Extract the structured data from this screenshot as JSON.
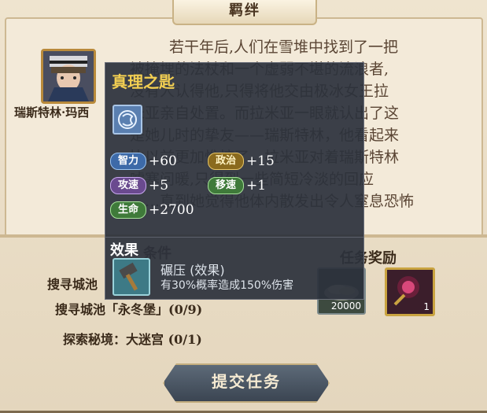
{
  "panel": {
    "title": "羁绊"
  },
  "hero": {
    "name": "瑞斯特林·玛西"
  },
  "story": {
    "lines": [
      "若干年后,人们在雪堆中找到了一把",
      "被掩埋的法杖和一个虚弱不堪的流浪者,",
      "没有人认得他,只得将他交由极冰女王拉",
      "米亚亲自处置。而拉米亚一眼就认出了这",
      "是她儿时的挚友——瑞斯特林，他看起来",
      "比以前更加憔悴了。拉米亚对着瑞斯特林",
      "嘘寒问暖,只得到一些简短冷淡的回应",
      "……直到她觉得他体内散发出令人窒息恐怖"
    ]
  },
  "conditions": {
    "header": "条件",
    "tasks": [
      "搜寻城池",
      "搜寻城池「永冬堡」(0/9)",
      "探索秘境：大迷宫 (0/1)"
    ]
  },
  "rewards": {
    "header": "任务奖励",
    "items": [
      {
        "icon": "coin-pile-icon",
        "count": "20000"
      },
      {
        "icon": "dark-orb-icon",
        "count": "1"
      }
    ]
  },
  "submit": {
    "label": "提交任务"
  },
  "tooltip": {
    "title": "真理之匙",
    "item_icon": "dragon-emblem-icon",
    "stats": [
      {
        "label": "智力",
        "value": "+60",
        "color": "blue"
      },
      {
        "label": "政治",
        "value": "+15",
        "color": "gold"
      },
      {
        "label": "攻速",
        "value": "+5",
        "color": "purple"
      },
      {
        "label": "移速",
        "value": "+1",
        "color": "green"
      },
      {
        "label": "生命",
        "value": "+2700",
        "color": "green"
      }
    ],
    "effect_header": "效果",
    "skill": {
      "icon": "hammer-icon",
      "name": "碾压 (效果)",
      "description": "有30%概率造成150%伤害"
    }
  }
}
